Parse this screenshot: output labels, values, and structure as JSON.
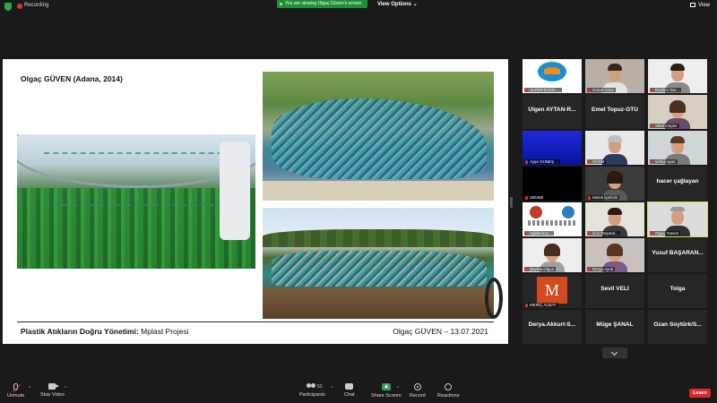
{
  "topbar": {
    "recording_label": "Recording",
    "viewing_banner": "You are viewing Olgaç Güven's screen",
    "view_options": "View Options",
    "view_options_caret": "⌄",
    "view_label": "View"
  },
  "slide": {
    "title": "Olgaç GÜVEN (Adana, 2014)",
    "footer_bold": "Plastik Atıkların Doğru Yönetimi:",
    "footer_rest": " Mplast Projesi",
    "footer_right": "Olgaç GÜVEN – 13.07.2021"
  },
  "participants": [
    {
      "type": "video",
      "label": "ALFER-EVCE-..."
    },
    {
      "type": "video",
      "label": "Gonul Cima"
    },
    {
      "type": "video",
      "label": "İbrahim Tas..."
    },
    {
      "type": "name",
      "name": "Ülgen AYTAN-R..."
    },
    {
      "type": "name",
      "name": "Emel Topuz-GTÜ"
    },
    {
      "type": "video",
      "label": "Sibel Güçler"
    },
    {
      "type": "video",
      "label": "Ayşe GÜNEŞ ..."
    },
    {
      "type": "video",
      "label": "SYGM"
    },
    {
      "type": "video",
      "label": "selma ayaz"
    },
    {
      "type": "video",
      "label": "280468"
    },
    {
      "type": "video",
      "label": "Melek İşinibilir"
    },
    {
      "type": "name",
      "name": "hacer çağlayan"
    },
    {
      "type": "video",
      "label": "Aylala Koç..."
    },
    {
      "type": "video",
      "label": "Ü.N.Tarşand..."
    },
    {
      "type": "video",
      "label": "Olgaç Güven"
    },
    {
      "type": "video",
      "label": "Şeyma Olgun"
    },
    {
      "type": "video",
      "label": "Derya Ayral"
    },
    {
      "type": "name",
      "name": "Yusuf BAŞARAN..."
    },
    {
      "type": "avatar",
      "label": "MERİÇ ALBAY",
      "letter": "M"
    },
    {
      "type": "name",
      "name": "Sevil VELİ"
    },
    {
      "type": "name",
      "name": "Tolga"
    },
    {
      "type": "name",
      "name": "Derya.Akkurt-S..."
    },
    {
      "type": "name",
      "name": "Müge ŞANAL"
    },
    {
      "type": "name",
      "name": "Ozan Soytürk/S..."
    }
  ],
  "toolbar": {
    "unmute": "Unmute",
    "stop_video": "Stop Video",
    "participants": "Participants",
    "participant_count": "53",
    "chat": "Chat",
    "share_screen": "Share Screen",
    "record": "Record",
    "reactions": "Reactions",
    "leave": "Leave",
    "caret": "^"
  }
}
